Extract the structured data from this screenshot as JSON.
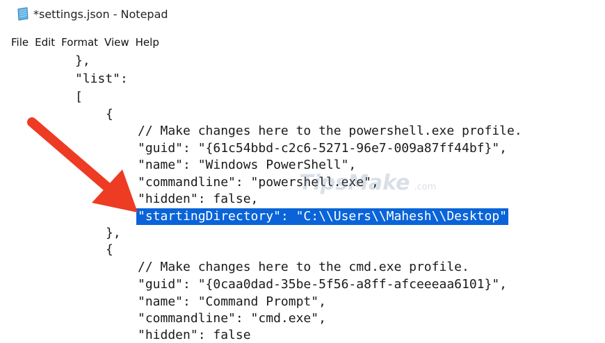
{
  "window": {
    "title": "*settings.json - Notepad",
    "app_icon": "notepad-icon"
  },
  "menu": [
    "File",
    "Edit",
    "Format",
    "View",
    "Help"
  ],
  "editor": {
    "lines": [
      "},",
      "\"list\":",
      "[",
      "{",
      "// Make changes here to the powershell.exe profile.",
      "\"guid\": \"{61c54bbd-c2c6-5271-96e7-009a87ff44bf}\",",
      "\"name\": \"Windows PowerShell\",",
      "\"commandline\": \"powershell.exe\",",
      "\"hidden\": false,",
      "\"startingDirectory\": \"C:\\\\Users\\\\Mahesh\\\\Desktop\"",
      "},",
      "{",
      "// Make changes here to the cmd.exe profile.",
      "\"guid\": \"{0caa0dad-35be-5f56-a8ff-afceeeaa6101}\",",
      "\"name\": \"Command Prompt\",",
      "\"commandline\": \"cmd.exe\",",
      "\"hidden\": false"
    ],
    "selected_line_index": 9,
    "selection_color": "#0a64d8"
  },
  "watermark": {
    "text": "TipsMake",
    "suffix": ".com"
  },
  "annotation": {
    "arrow_color": "#ee3b24",
    "icon": "red-arrow-icon"
  }
}
